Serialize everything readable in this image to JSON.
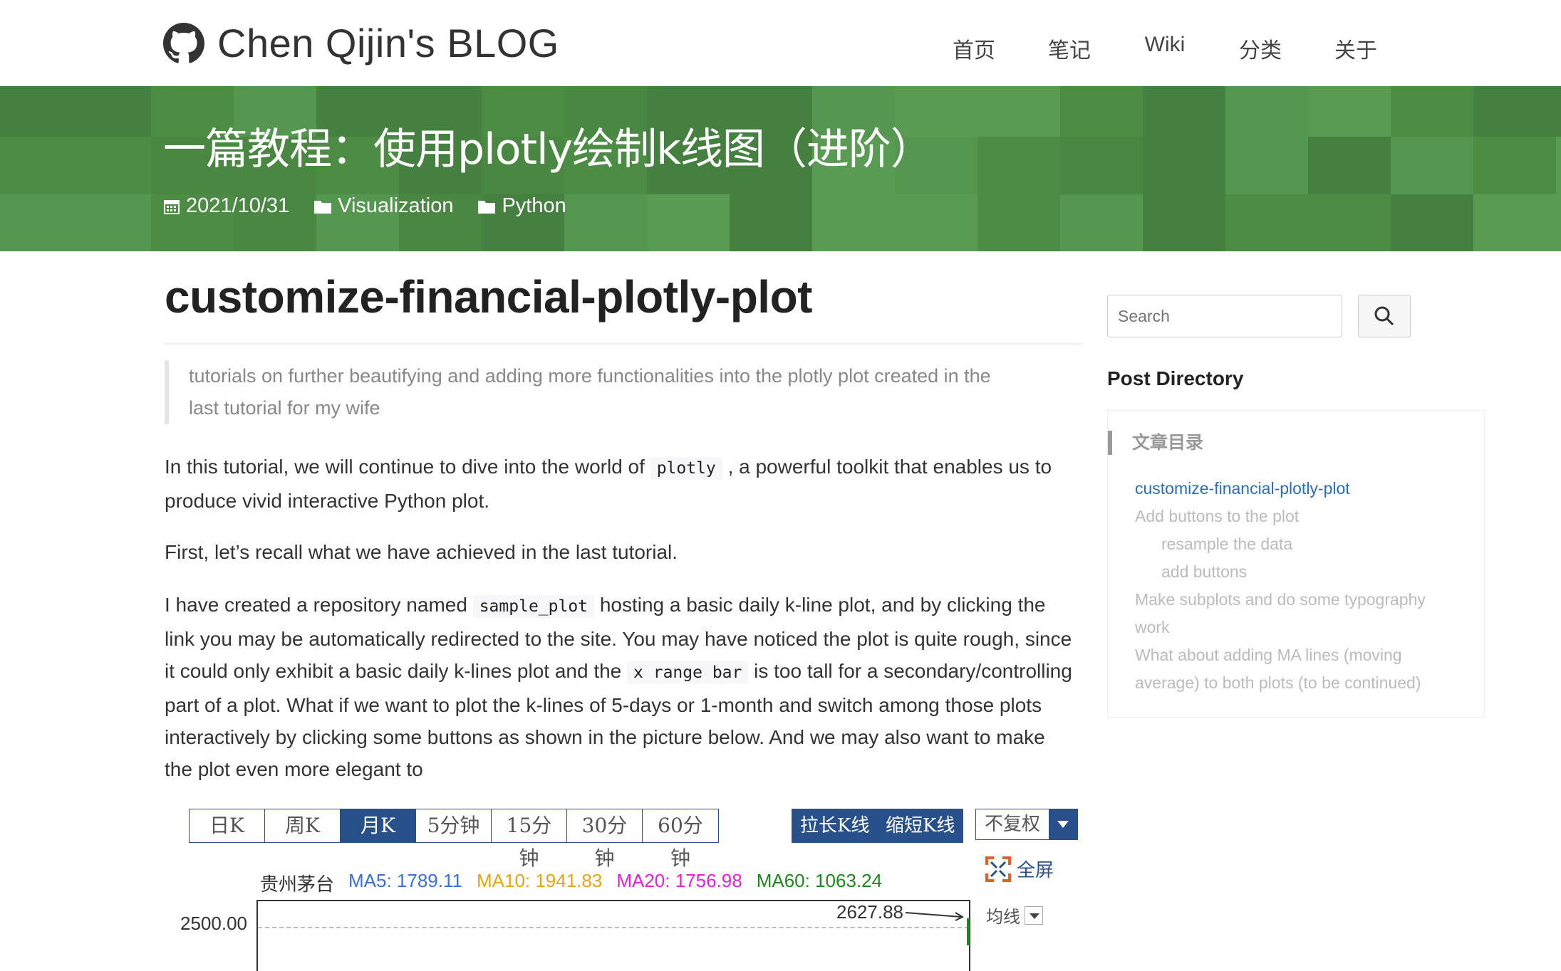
{
  "nav": {
    "brand": "Chen Qijin's BLOG",
    "links": [
      "首页",
      "笔记",
      "Wiki",
      "分类",
      "关于"
    ]
  },
  "header": {
    "title": "一篇教程：使用plotly绘制k线图（进阶）",
    "date": "2021/10/31",
    "categories": [
      "Visualization",
      "Python"
    ]
  },
  "post": {
    "title": "customize-financial-plotly-plot",
    "quote_line1": "tutorials on further beautifying and adding more functionalities into the plotly plot created in the",
    "quote_line2": "last tutorial for my wife",
    "p1_a": "In this tutorial, we will continue to dive into the world of",
    "p1_code": "plotly",
    "p1_b": ", a powerful toolkit that enables us to",
    "p1_c": "produce vivid interactive Python plot.",
    "p2": "First, let’s recall what we have achieved in the last tutorial.",
    "p3_a": "I have created a repository named",
    "p3_code1": "sample_plot",
    "p3_b": "hosting a basic daily k-line plot, and by clicking the",
    "p3_c": "link you may be automatically redirected to the site. You may have noticed the plot is quite rough, since",
    "p3_d": "it could only exhibit a basic daily k-lines plot and the",
    "p3_code2": "x range bar",
    "p3_e": "is too tall for a secondary/controlling",
    "p3_f": "part of a plot. What if we want to plot the k-lines of 5-days or 1-month and switch among those plots",
    "p3_g": "interactively by clicking some buttons as shown in the picture below. And we may also want to make",
    "p3_h": "the plot even more elegant to"
  },
  "kchart": {
    "tabs": [
      "日K",
      "周K",
      "月K",
      "5分钟",
      "15分钟",
      "30分钟",
      "60分钟"
    ],
    "active_tab": "月K",
    "btn_lengthen": "拉长K线",
    "btn_shorten": "缩短K线",
    "select_value": "不复权",
    "fullscreen": "全屏",
    "stock_name": "贵州茅台",
    "ma5": "MA5: 1789.11",
    "ma10": "MA10: 1941.83",
    "ma20": "MA20: 1756.98",
    "ma60": "MA60: 1063.24",
    "y_tick": "2500.00",
    "peak_label": "2627.88",
    "ma_select": "均线",
    "colors": {
      "ma5": "#3a6fd8",
      "ma10": "#e6a417",
      "ma20": "#e022d8",
      "ma60": "#1b8a1b",
      "accent": "#28518c"
    }
  },
  "sidebar": {
    "search_placeholder": "Search",
    "directory_title": "Post Directory",
    "toc_title": "文章目录",
    "toc": [
      {
        "label": "customize-financial-plotly-plot",
        "level": 1,
        "active": true
      },
      {
        "label": "Add buttons to the plot",
        "level": 1
      },
      {
        "label": "resample the data",
        "level": 2
      },
      {
        "label": "add buttons",
        "level": 2
      },
      {
        "label": "Make subplots and do some typography",
        "level": 1
      },
      {
        "label": "work",
        "level": 1
      },
      {
        "label": "What about adding MA lines (moving",
        "level": 1
      },
      {
        "label": "average) to both plots (to be continued)",
        "level": 1
      }
    ]
  },
  "theme": {
    "header_green": "#4d8c44",
    "link_blue": "#2a6fba"
  }
}
